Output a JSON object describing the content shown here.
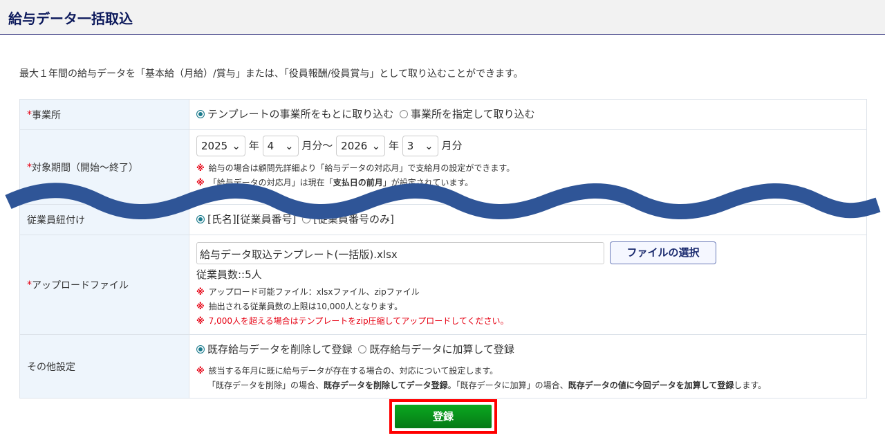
{
  "page": {
    "title": "給与データ一括取込",
    "description": "最大１年間の給与データを「基本給（月給）/賞与」または、「役員報酬/役員賞与」として取り込むことができます。"
  },
  "form": {
    "office": {
      "label": "事業所",
      "required": "*",
      "options": [
        "テンプレートの事業所をもとに取り込む",
        "事業所を指定して取り込む"
      ],
      "selected": 0
    },
    "period": {
      "label": "対象期間（開始～終了）",
      "required": "*",
      "start_year": "2025",
      "year_unit": "年",
      "start_month": "4",
      "month_unit": "月分",
      "tilde": "～",
      "end_year": "2026",
      "end_month": "3",
      "note_mark": "※",
      "note1": "給与の場合は顧問先詳細より「給与データの対応月」で支給月の設定ができます。",
      "note2_a": "「給与データの対応月」は現在「",
      "note2_b": "支払日の前月",
      "note2_c": "」が設定されています。"
    },
    "employee_link": {
      "label": "従業員紐付け",
      "options": [
        "[氏名][従業員番号]",
        "[従業員番号のみ]"
      ],
      "selected": 0
    },
    "upload": {
      "label": "アップロードファイル",
      "required": "*",
      "filename": "給与データ取込テンプレート(一括版).xlsx",
      "select_button": "ファイルの選択",
      "count": "従業員数::5人",
      "notes": [
        "アップロード可能ファイル：xlsxファイル、zipファイル",
        "抽出される従業員数の上限は10,000人となります。",
        "7,000人を超える場合はテンプレートをzip圧縮してアップロードしてください。"
      ]
    },
    "other": {
      "label": "その他設定",
      "options": [
        "既存給与データを削除して登録",
        "既存給与データに加算して登録"
      ],
      "selected": 0,
      "note1": "該当する年月に既に給与データが存在する場合の、対応について設定します。",
      "note2": [
        "「既存データを削除」の場合、",
        "既存データを削除してデータ登録",
        "。「既存データに加算」の場合、",
        "既存データの値に今回データを加算して登録",
        "します。"
      ]
    }
  },
  "submit_label": "登録",
  "colors": {
    "accent": "#2f5597",
    "required": "#e60012",
    "submit": "#0a9a1e"
  }
}
